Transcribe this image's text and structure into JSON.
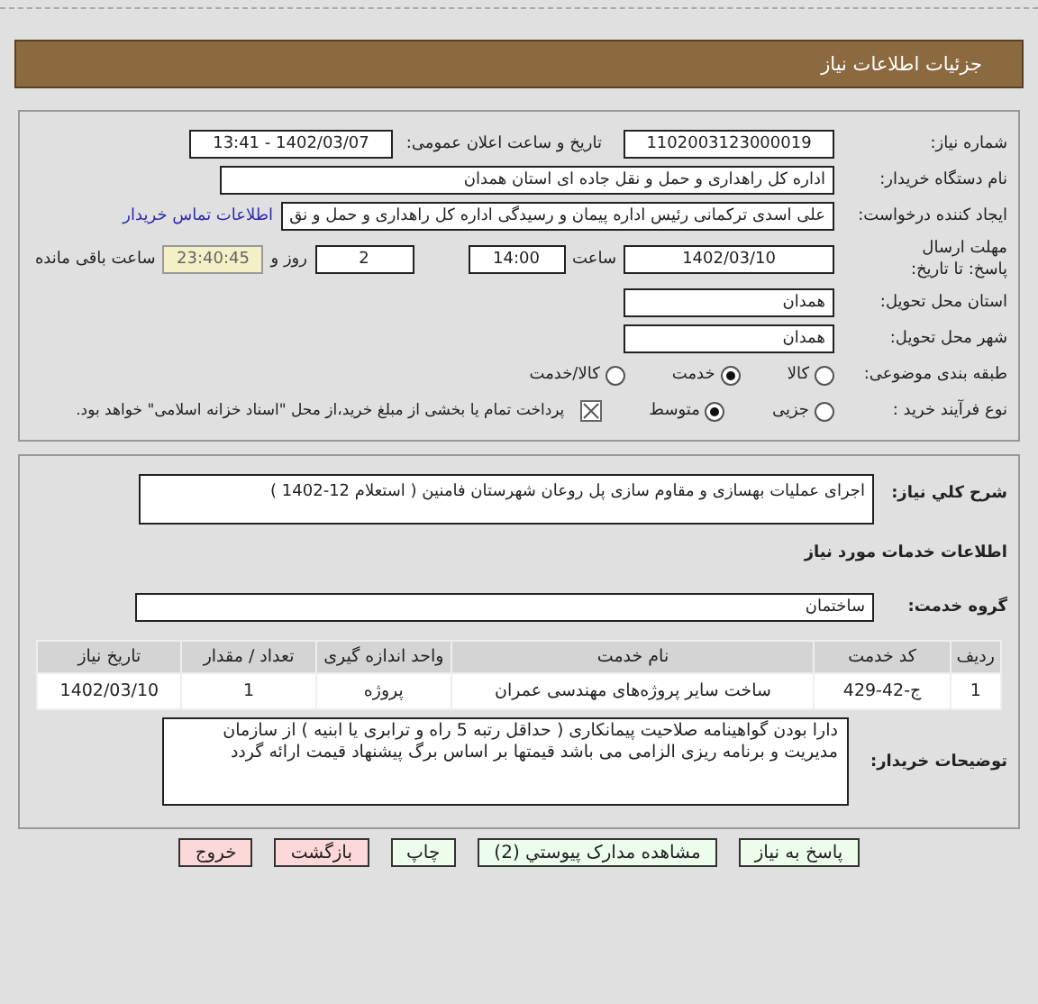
{
  "header": {
    "title": "جزئیات اطلاعات نیاز"
  },
  "need_number": {
    "label": "شماره نیاز:",
    "value": "1102003123000019"
  },
  "announce_date": {
    "label": "تاریخ و ساعت اعلان عمومی:",
    "value": "1402/03/07 - 13:41"
  },
  "buyer": {
    "label": "نام دستگاه خریدار:",
    "value": "اداره کل راهداری و حمل و نقل جاده ای استان همدان"
  },
  "requester": {
    "label": "ایجاد کننده درخواست:",
    "value": "علی اسدی ترکمانی رئیس اداره پیمان و رسیدگی اداره کل راهداری و حمل و نق",
    "link": "اطلاعات تماس خریدار"
  },
  "deadline": {
    "label": "مهلت ارسال پاسخ: تا تاریخ:",
    "date": "1402/03/10",
    "time_label": "ساعت",
    "time": "14:00",
    "days": "2",
    "days_label": "روز و",
    "remaining": "23:40:45",
    "remaining_label": "ساعت باقی مانده"
  },
  "province": {
    "label": "استان محل تحویل:",
    "value": "همدان"
  },
  "city": {
    "label": "شهر محل تحویل:",
    "value": "همدان"
  },
  "category": {
    "label": "طبقه بندی موضوعی:",
    "options": [
      {
        "label": "کالا",
        "selected": false
      },
      {
        "label": "خدمت",
        "selected": true
      },
      {
        "label": "کالا/خدمت",
        "selected": false
      }
    ]
  },
  "purchase_process": {
    "label": "نوع فرآیند خرید :",
    "options": [
      {
        "label": "جزیی",
        "selected": false
      },
      {
        "label": "متوسط",
        "selected": true
      }
    ],
    "payment_note": {
      "label": "پرداخت تمام یا بخشی از مبلغ خرید،از محل \"اسناد خزانه اسلامی\" خواهد بود.",
      "checked": true
    }
  },
  "description": {
    "label": "شرح کلي نياز:",
    "value": "اجرای عملیات بهسازی و مقاوم سازی پل روعان شهرستان فامنین ( استعلام 12-1402 )"
  },
  "services_heading": "اطلاعات خدمات مورد نیاز",
  "service_group": {
    "label": "گروه خدمت:",
    "value": "ساختمان"
  },
  "table": {
    "columns": [
      "ردیف",
      "کد خدمت",
      "نام خدمت",
      "واحد اندازه گیری",
      "تعداد / مقدار",
      "تاریخ نیاز"
    ],
    "rows": [
      [
        "1",
        "ج-42-429",
        "ساخت سایر پروژه‌های مهندسی عمران",
        "پروژه",
        "1",
        "1402/03/10"
      ]
    ]
  },
  "buyer_notes": {
    "label": "توضیحات خریدار:",
    "value": "دارا بودن گواهینامه صلاحیت پیمانکاری ( حداقل رتبه 5 راه و ترابری یا ابنیه ) از سازمان مدیریت و برنامه ریزی الزامی می باشد قیمتها بر اساس برگ پیشنهاد قیمت ارائه گردد"
  },
  "buttons": [
    {
      "label": "پاسخ به نیاز",
      "kind": "action"
    },
    {
      "label": "مشاهده مدارک پیوستي (2)",
      "kind": "action"
    },
    {
      "label": "چاپ",
      "kind": "action"
    },
    {
      "label": "بازگشت",
      "kind": "exit"
    },
    {
      "label": "خروج",
      "kind": "exit"
    }
  ]
}
